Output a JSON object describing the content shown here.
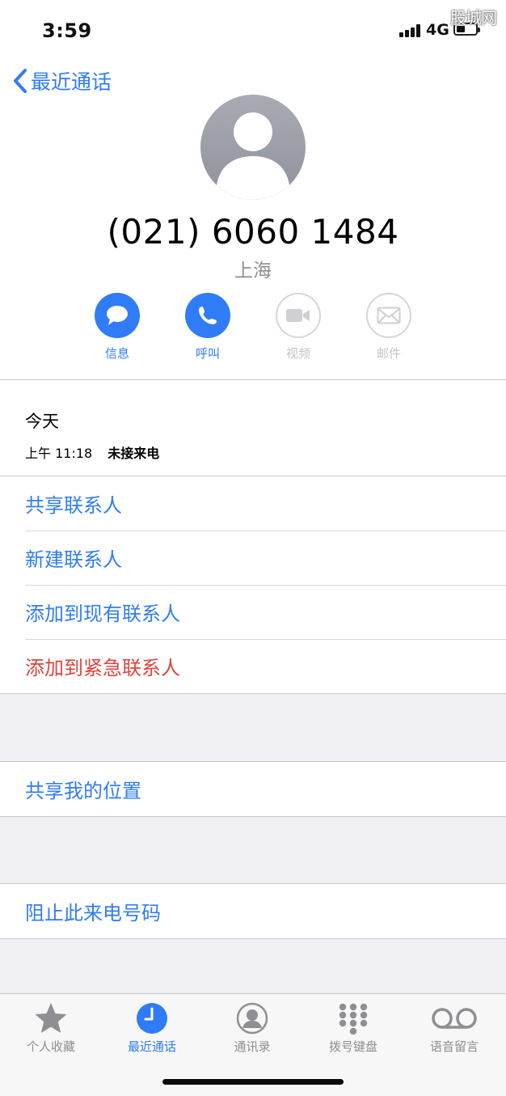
{
  "status": {
    "time": "3:59",
    "network": "4G",
    "watermark": "股城网"
  },
  "nav": {
    "back_label": "最近通话"
  },
  "contact": {
    "phone_number": "(021) 6060 1484",
    "location": "上海"
  },
  "actions": [
    {
      "label": "信息",
      "icon": "message-icon",
      "enabled": true
    },
    {
      "label": "呼叫",
      "icon": "phone-icon",
      "enabled": true
    },
    {
      "label": "视频",
      "icon": "video-icon",
      "enabled": false
    },
    {
      "label": "邮件",
      "icon": "mail-icon",
      "enabled": false
    }
  ],
  "recent": {
    "day": "今天",
    "time": "上午 11:18",
    "type": "未接来电"
  },
  "options": {
    "share_contact": "共享联系人",
    "new_contact": "新建联系人",
    "add_existing": "添加到现有联系人",
    "add_emergency": "添加到紧急联系人",
    "share_location": "共享我的位置",
    "block_caller": "阻止此来电号码"
  },
  "tabs": [
    {
      "label": "个人收藏",
      "icon": "star-icon",
      "active": false
    },
    {
      "label": "最近通话",
      "icon": "clock-icon",
      "active": true
    },
    {
      "label": "通讯录",
      "icon": "contacts-icon",
      "active": false
    },
    {
      "label": "拨号键盘",
      "icon": "keypad-icon",
      "active": false
    },
    {
      "label": "语音留言",
      "icon": "voicemail-icon",
      "active": false
    }
  ],
  "colors": {
    "accent": "#2f7cf6",
    "destructive": "#e0443c",
    "disabled": "#c4c4c8",
    "inactive_tab": "#8e8e93"
  }
}
